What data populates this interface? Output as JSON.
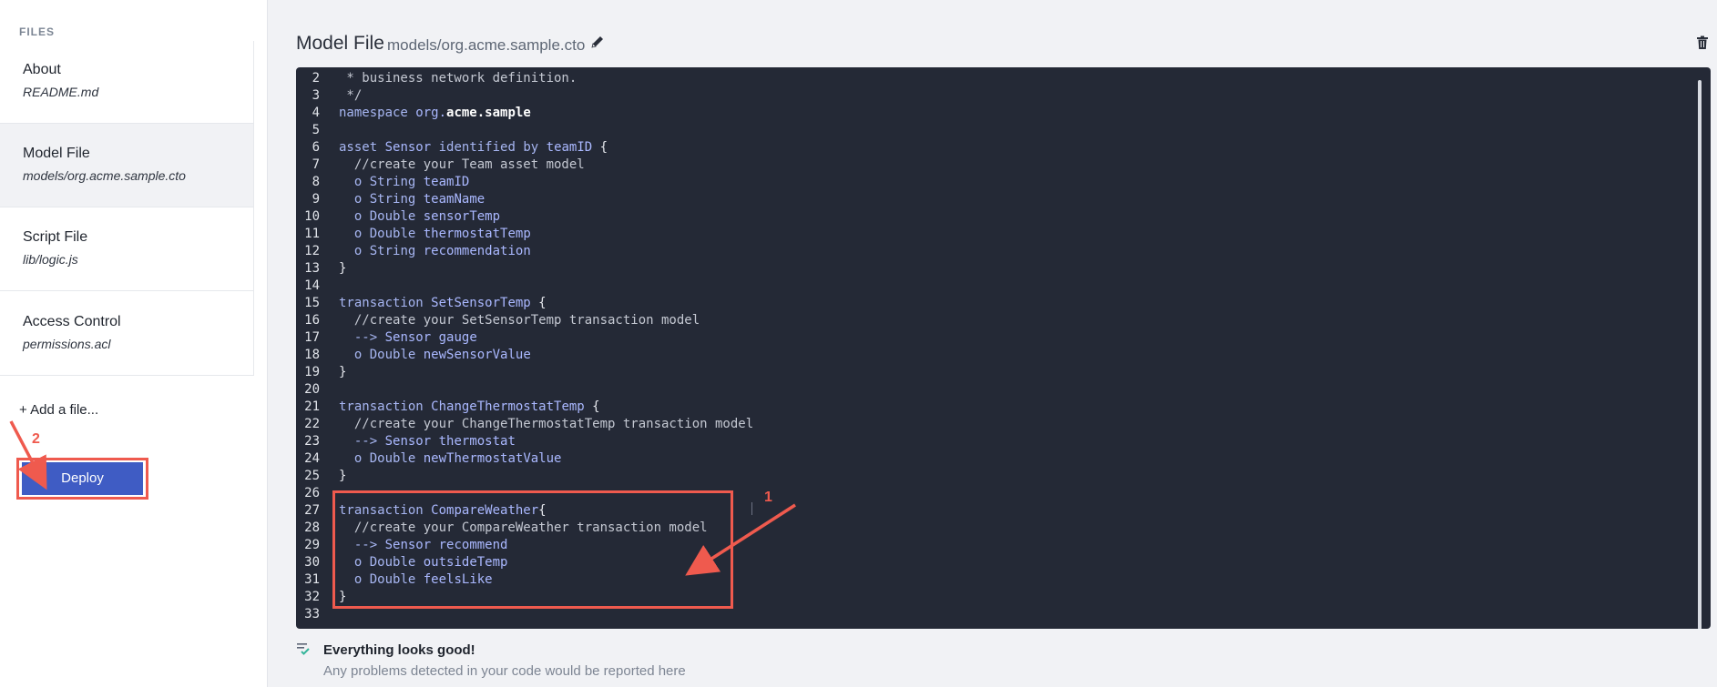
{
  "sidebar": {
    "files_label": "FILES",
    "items": [
      {
        "title": "About",
        "path": "README.md"
      },
      {
        "title": "Model File",
        "path": "models/org.acme.sample.cto"
      },
      {
        "title": "Script File",
        "path": "lib/logic.js"
      },
      {
        "title": "Access Control",
        "path": "permissions.acl"
      }
    ],
    "add_file_label": "+ Add a file...",
    "deploy_label": "Deploy"
  },
  "header": {
    "title": "Model File",
    "path": "models/org.acme.sample.cto",
    "edit_icon": "pencil-icon",
    "delete_icon": "trash-icon"
  },
  "editor": {
    "lines": [
      {
        "n": "2",
        "text": " * business network definition."
      },
      {
        "n": "3",
        "text": " */"
      },
      {
        "n": "4",
        "text": "namespace org.acme.sample"
      },
      {
        "n": "5",
        "text": ""
      },
      {
        "n": "6",
        "text": "asset Sensor identified by teamID {"
      },
      {
        "n": "7",
        "text": "  //create your Team asset model"
      },
      {
        "n": "8",
        "text": "  o String teamID"
      },
      {
        "n": "9",
        "text": "  o String teamName"
      },
      {
        "n": "10",
        "text": "  o Double sensorTemp"
      },
      {
        "n": "11",
        "text": "  o Double thermostatTemp"
      },
      {
        "n": "12",
        "text": "  o String recommendation"
      },
      {
        "n": "13",
        "text": "}"
      },
      {
        "n": "14",
        "text": ""
      },
      {
        "n": "15",
        "text": "transaction SetSensorTemp {"
      },
      {
        "n": "16",
        "text": "  //create your SetSensorTemp transaction model"
      },
      {
        "n": "17",
        "text": "  --> Sensor gauge"
      },
      {
        "n": "18",
        "text": "  o Double newSensorValue"
      },
      {
        "n": "19",
        "text": "}"
      },
      {
        "n": "20",
        "text": ""
      },
      {
        "n": "21",
        "text": "transaction ChangeThermostatTemp {"
      },
      {
        "n": "22",
        "text": "  //create your ChangeThermostatTemp transaction model"
      },
      {
        "n": "23",
        "text": "  --> Sensor thermostat"
      },
      {
        "n": "24",
        "text": "  o Double newThermostatValue"
      },
      {
        "n": "25",
        "text": "}"
      },
      {
        "n": "26",
        "text": ""
      },
      {
        "n": "27",
        "text": "transaction CompareWeather{"
      },
      {
        "n": "28",
        "text": "  //create your CompareWeather transaction model"
      },
      {
        "n": "29",
        "text": "  --> Sensor recommend"
      },
      {
        "n": "30",
        "text": "  o Double outsideTemp"
      },
      {
        "n": "31",
        "text": "  o Double feelsLike"
      },
      {
        "n": "32",
        "text": "}"
      },
      {
        "n": "33",
        "text": ""
      }
    ]
  },
  "status": {
    "title": "Everything looks good!",
    "subtitle": "Any problems detected in your code would be reported here"
  },
  "annotations": {
    "label_1": "1",
    "label_2": "2",
    "color": "#ef5a4e"
  },
  "colors": {
    "editor_bg": "#242936",
    "deploy_bg": "#3f5cc4",
    "annotation": "#ef5a4e"
  }
}
